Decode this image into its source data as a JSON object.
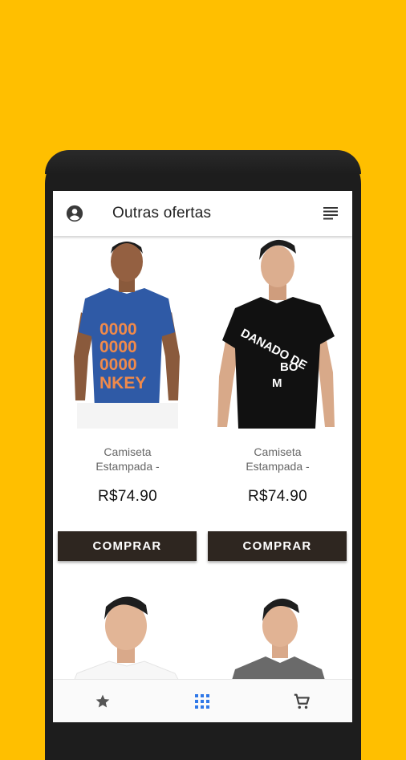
{
  "app": {
    "title": "Outras ofertas",
    "accent": "#FFBF00",
    "button_color": "#2e2620"
  },
  "appbar": {
    "account_icon": "account-circle-icon",
    "sort_icon": "sort-lines-icon"
  },
  "products": [
    {
      "name": "Camiseta Estampada -",
      "price": "R$74.90",
      "buy_label": "COMPRAR",
      "shirt_color": "#2f5aa6",
      "print_color": "#f08a4b"
    },
    {
      "name": "Camiseta Estampada -",
      "price": "R$74.90",
      "buy_label": "COMPRAR",
      "shirt_color": "#111111",
      "print_color": "#ffffff"
    },
    {
      "name": "",
      "price": "",
      "buy_label": "",
      "shirt_color": "#ffffff",
      "print_color": ""
    },
    {
      "name": "",
      "price": "",
      "buy_label": "",
      "shirt_color": "#6a6a6a",
      "print_color": ""
    }
  ],
  "bottom_nav": [
    {
      "icon": "star-icon",
      "active": false
    },
    {
      "icon": "grid-icon",
      "active": true
    },
    {
      "icon": "cart-icon",
      "active": false
    }
  ]
}
